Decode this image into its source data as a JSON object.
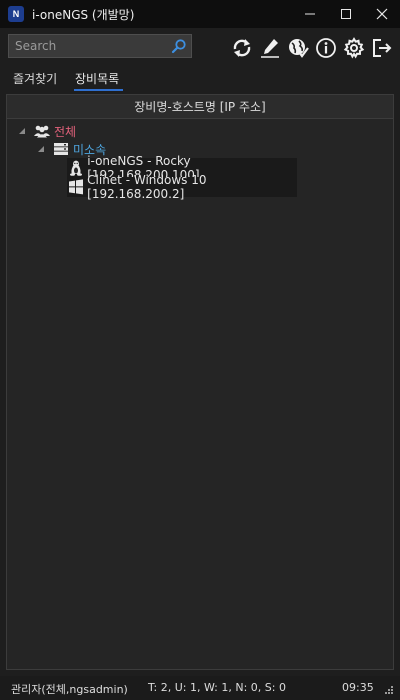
{
  "window": {
    "title": "i-oneNGS (개발망)",
    "logo_text": "N"
  },
  "search": {
    "placeholder": "Search",
    "value": ""
  },
  "toolbar": {
    "icons": [
      "refresh-icon",
      "edit-icon",
      "globe-check-icon",
      "info-icon",
      "settings-icon",
      "logout-icon"
    ]
  },
  "tabs": [
    {
      "label": "즐겨찾기",
      "active": false
    },
    {
      "label": "장비목록",
      "active": true
    }
  ],
  "list": {
    "column_header": "장비명-호스트명 [IP 주소]",
    "root": {
      "label": "전체",
      "icon": "users-group-icon",
      "color": "#e0617a"
    },
    "group": {
      "label": "미소속",
      "icon": "server-rack-icon",
      "color": "#4ea6e0"
    },
    "devices": [
      {
        "label": "i-oneNGS - Rocky [192.168.200.100]",
        "icon": "linux-penguin-icon"
      },
      {
        "label": "Clinet - Windows 10 [192.168.200.2]",
        "icon": "windows-logo-icon"
      }
    ]
  },
  "status": {
    "user": "관리자(전체,ngsadmin)",
    "counts": "T: 2, U: 1, W: 1, N: 0, S: 0",
    "time": "09:35"
  },
  "colors": {
    "accent": "#2f6fcf",
    "root_label": "#e0617a",
    "group_label": "#4ea6e0"
  }
}
